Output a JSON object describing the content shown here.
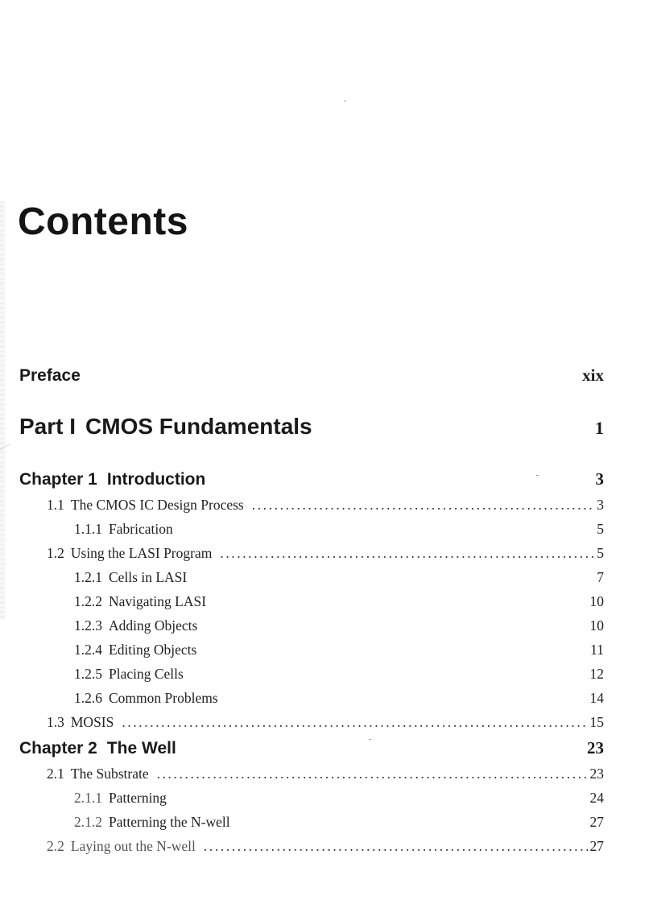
{
  "title": "Contents",
  "entries": {
    "preface": {
      "label": "Preface",
      "page": "xix"
    },
    "part1": {
      "num": "Part I",
      "label": "CMOS Fundamentals",
      "page": "1"
    },
    "ch1": {
      "num": "Chapter 1",
      "label": "Introduction",
      "page": "3"
    },
    "s1_1": {
      "num": "1.1",
      "label": "The CMOS IC Design Process",
      "leader": "..........................................................................",
      "page": "3"
    },
    "s1_1_1": {
      "num": "1.1.1",
      "label": "Fabrication",
      "page": "5"
    },
    "s1_2": {
      "num": "1.2",
      "label": "Using the LASI Program",
      "leader": "..........................................................................",
      "page": "5"
    },
    "s1_2_1": {
      "num": "1.2.1",
      "label": "Cells in LASI",
      "page": "7"
    },
    "s1_2_2": {
      "num": "1.2.2",
      "label": "Navigating LASI",
      "page": "10"
    },
    "s1_2_3": {
      "num": "1.2.3",
      "label": "Adding Objects",
      "page": "10"
    },
    "s1_2_4": {
      "num": "1.2.4",
      "label": "Editing Objects",
      "page": "11"
    },
    "s1_2_5": {
      "num": "1.2.5",
      "label": "Placing Cells",
      "page": "12"
    },
    "s1_2_6": {
      "num": "1.2.6",
      "label": "Common Problems",
      "page": "14"
    },
    "s1_3": {
      "num": "1.3",
      "label": "MOSIS",
      "leader": ".....................................................................................................",
      "page": "15"
    },
    "ch2": {
      "num": "Chapter 2",
      "label": "The Well",
      "page": "23"
    },
    "s2_1": {
      "num": "2.1",
      "label": "The Substrate",
      "leader": ".....................................................................................................",
      "page": "23"
    },
    "s2_1_1": {
      "num": "2.1.1",
      "label": "Patterning",
      "page": "24"
    },
    "s2_1_2": {
      "num": "2.1.2",
      "label": "Patterning the N-well",
      "page": "27"
    },
    "s2_2": {
      "num": "2.2",
      "label": "Laying out the N-well",
      "leader": ".....................................................................................................",
      "page": "27"
    }
  }
}
